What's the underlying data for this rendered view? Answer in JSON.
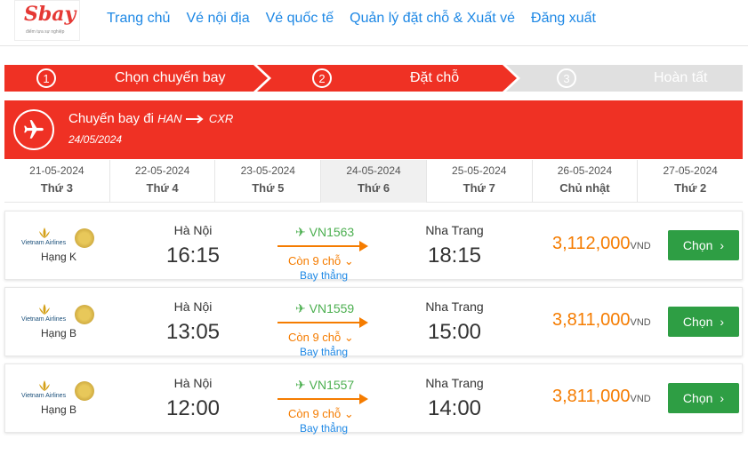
{
  "logo": {
    "text_main": "S",
    "text_rest": "bay",
    "tagline": "điểm tựa sự nghiệp"
  },
  "nav": [
    {
      "label": "Trang chủ"
    },
    {
      "label": "Vé nội địa"
    },
    {
      "label": "Vé quốc tế"
    },
    {
      "label": "Quản lý đặt chỗ & Xuất vé"
    },
    {
      "label": "Đăng xuất"
    }
  ],
  "steps": [
    {
      "num": "1",
      "label": "Chọn chuyến bay",
      "state": "active"
    },
    {
      "num": "2",
      "label": "Đặt chỗ",
      "state": "active"
    },
    {
      "num": "3",
      "label": "Hoàn tất",
      "state": "inactive"
    }
  ],
  "flight_header": {
    "title": "Chuyến bay đi",
    "from": "HAN",
    "to": "CXR",
    "date": "24/05/2024"
  },
  "dates": [
    {
      "date": "21-05-2024",
      "weekday": "Thứ 3"
    },
    {
      "date": "22-05-2024",
      "weekday": "Thứ 4"
    },
    {
      "date": "23-05-2024",
      "weekday": "Thứ 5"
    },
    {
      "date": "24-05-2024",
      "weekday": "Thứ 6",
      "active": true
    },
    {
      "date": "25-05-2024",
      "weekday": "Thứ 7"
    },
    {
      "date": "26-05-2024",
      "weekday": "Chủ nhật"
    },
    {
      "date": "27-05-2024",
      "weekday": "Thứ 2"
    }
  ],
  "flights": [
    {
      "airline": "Vietnam Airlines",
      "fare_class": "Hạng K",
      "from_city": "Hà Nội",
      "dep_time": "16:15",
      "flight_no": "VN1563",
      "seats": "Còn 9 chỗ",
      "stops": "Bay thẳng",
      "to_city": "Nha Trang",
      "arr_time": "18:15",
      "price": "3,112,000",
      "currency": "VND",
      "button": "Chọn"
    },
    {
      "airline": "Vietnam Airlines",
      "fare_class": "Hạng B",
      "from_city": "Hà Nội",
      "dep_time": "13:05",
      "flight_no": "VN1559",
      "seats": "Còn 9 chỗ",
      "stops": "Bay thẳng",
      "to_city": "Nha Trang",
      "arr_time": "15:00",
      "price": "3,811,000",
      "currency": "VND",
      "button": "Chọn"
    },
    {
      "airline": "Vietnam Airlines",
      "fare_class": "Hạng B",
      "from_city": "Hà Nội",
      "dep_time": "12:00",
      "flight_no": "VN1557",
      "seats": "Còn 9 chỗ",
      "stops": "Bay thẳng",
      "to_city": "Nha Trang",
      "arr_time": "14:00",
      "price": "3,811,000",
      "currency": "VND",
      "button": "Chọn"
    }
  ],
  "colors": {
    "brand_red": "#ef3124",
    "nav_blue": "#1e88e5",
    "green": "#2e9e44",
    "orange": "#f57c00",
    "step_inactive": "#e0e0e0"
  }
}
